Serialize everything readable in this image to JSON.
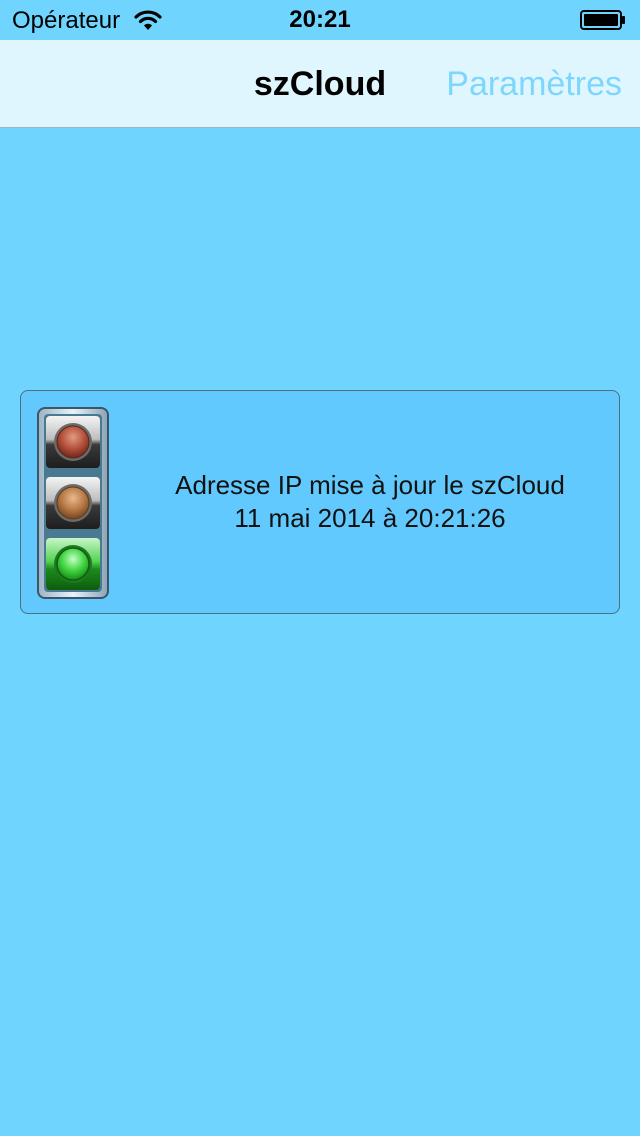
{
  "status_bar": {
    "carrier": "Opérateur",
    "time": "20:21"
  },
  "nav": {
    "title": "szCloud",
    "settings_label": "Paramètres"
  },
  "status_panel": {
    "line1": "Adresse IP mise à jour le szCloud",
    "line2": "11 mai 2014 à 20:21:26",
    "active_light": "green"
  },
  "colors": {
    "background": "#6fd5fe",
    "nav_background": "#dff6fe",
    "accent": "#7fd6fc",
    "panel": "#61c9fd"
  },
  "icons": [
    "wifi-icon",
    "battery-icon",
    "traffic-light-icon"
  ]
}
